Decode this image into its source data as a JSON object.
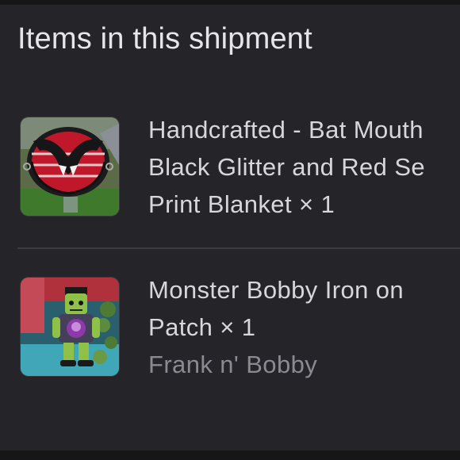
{
  "shipment": {
    "title": "Items in this shipment",
    "items": [
      {
        "image_label": "stained-glass bat mouth suncatcher photo",
        "title_lines": [
          "Handcrafted - Bat Mouth",
          "Black Glitter and Red Se",
          "Print Blanket × 1"
        ],
        "seller": ""
      },
      {
        "image_label": "monster bobby iron-on patch photo",
        "title_lines": [
          "Monster Bobby Iron on",
          "Patch × 1"
        ],
        "seller": "Frank n' Bobby"
      }
    ]
  },
  "colors": {
    "background": "#242429",
    "primary_text": "#d6d6db",
    "secondary_text": "#8a8a90",
    "divider": "#3b3b41"
  }
}
